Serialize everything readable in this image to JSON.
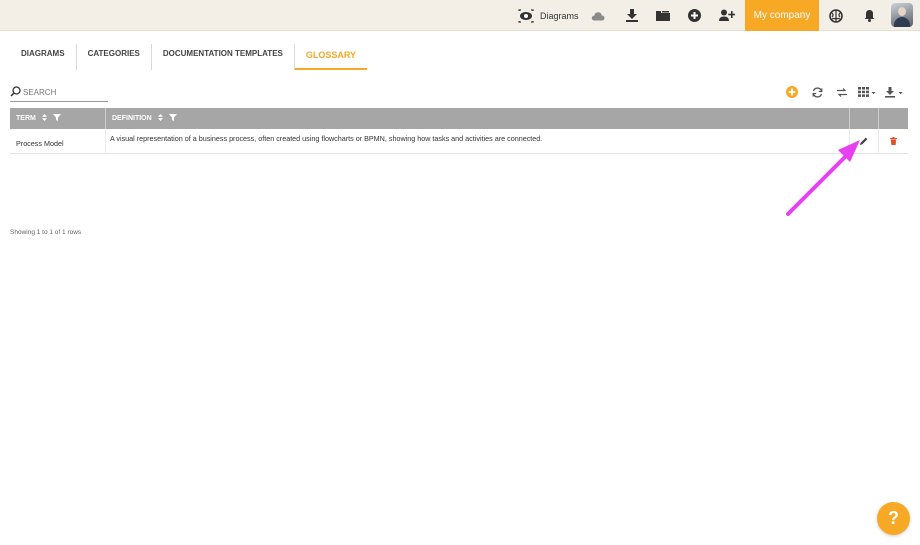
{
  "topbar": {
    "diagrams_label": "Diagrams",
    "company_label": "My company",
    "icons": [
      "diagrams-eye-icon",
      "cloud-icon",
      "download-icon",
      "folder-icon",
      "plus-circle-icon",
      "add-user-icon",
      "brain-icon",
      "bell-icon",
      "avatar"
    ]
  },
  "tabs": [
    {
      "label": "DIAGRAMS",
      "active": false
    },
    {
      "label": "CATEGORIES",
      "active": false
    },
    {
      "label": "DOCUMENTATION TEMPLATES",
      "active": false
    },
    {
      "label": "GLOSSARY",
      "active": true
    }
  ],
  "search": {
    "placeholder": "SEARCH",
    "value": ""
  },
  "toolbar": {
    "icons": [
      "add-circle-icon",
      "refresh-icon",
      "toggle-icon",
      "columns-icon",
      "export-icon"
    ]
  },
  "table": {
    "columns": [
      {
        "label": "TERM"
      },
      {
        "label": "DEFINITION"
      }
    ],
    "rows": [
      {
        "term": "Process Model",
        "definition": "A visual representation of a business process, often created using flowcharts or BPMN, showing how tasks and activities are connected."
      }
    ]
  },
  "footer": {
    "showing": "Showing 1 to 1 of 1 rows"
  },
  "help": {
    "label": "?"
  },
  "colors": {
    "accent": "#f7a825",
    "header_gray": "#a6a6a6",
    "delete_red": "#e0522a",
    "annotation": "#e83ff0"
  }
}
